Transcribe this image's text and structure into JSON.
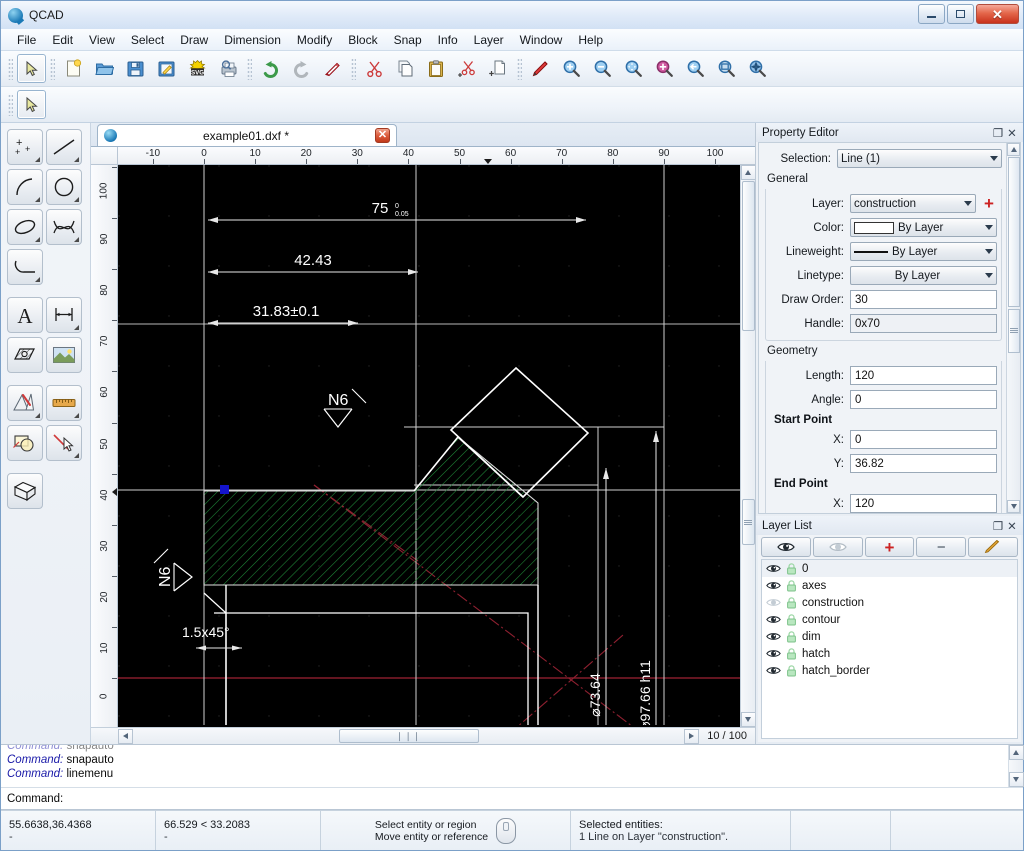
{
  "window": {
    "title": "QCAD",
    "minimize_label": "Minimize",
    "maximize_label": "Maximize",
    "close_label": "✕"
  },
  "menubar": {
    "items": [
      {
        "label": "File"
      },
      {
        "label": "Edit"
      },
      {
        "label": "View"
      },
      {
        "label": "Select"
      },
      {
        "label": "Draw"
      },
      {
        "label": "Dimension"
      },
      {
        "label": "Modify"
      },
      {
        "label": "Block"
      },
      {
        "label": "Snap"
      },
      {
        "label": "Info"
      },
      {
        "label": "Layer"
      },
      {
        "label": "Window"
      },
      {
        "label": "Help"
      }
    ]
  },
  "toolbar": {
    "items": [
      {
        "name": "select-pointer-icon",
        "tooltip": "Select"
      },
      {
        "name": "new-file-icon",
        "tooltip": "New"
      },
      {
        "name": "open-folder-icon",
        "tooltip": "Open"
      },
      {
        "name": "save-icon",
        "tooltip": "Save"
      },
      {
        "name": "save-as-icon",
        "tooltip": "Save As"
      },
      {
        "name": "export-svg-icon",
        "tooltip": "Export SVG"
      },
      {
        "name": "print-preview-icon",
        "tooltip": "Print Preview"
      },
      {
        "name": "undo-icon",
        "tooltip": "Undo"
      },
      {
        "name": "redo-icon",
        "tooltip": "Redo"
      },
      {
        "name": "erase-icon",
        "tooltip": "Erase"
      },
      {
        "name": "cut-icon",
        "tooltip": "Cut"
      },
      {
        "name": "cut-scissors-icon",
        "tooltip": "Cut"
      },
      {
        "name": "copy-icon",
        "tooltip": "Copy"
      },
      {
        "name": "paste-icon",
        "tooltip": "Paste"
      },
      {
        "name": "cut-ref-icon",
        "tooltip": "Cut with reference"
      },
      {
        "name": "copy-ref-icon",
        "tooltip": "Copy with reference"
      },
      {
        "name": "pencil-draw-icon",
        "tooltip": "Draw"
      },
      {
        "name": "zoom-in-icon",
        "tooltip": "Zoom In"
      },
      {
        "name": "zoom-out-icon",
        "tooltip": "Zoom Out"
      },
      {
        "name": "zoom-auto-icon",
        "tooltip": "Auto Zoom"
      },
      {
        "name": "zoom-selection-icon",
        "tooltip": "Zoom to Selection"
      },
      {
        "name": "zoom-previous-icon",
        "tooltip": "Previous View"
      },
      {
        "name": "zoom-window-icon",
        "tooltip": "Zoom Window"
      },
      {
        "name": "zoom-pan-icon",
        "tooltip": "Pan Zoom"
      }
    ],
    "row2": [
      {
        "name": "select-pointer-icon",
        "tooltip": "Select Entity"
      }
    ]
  },
  "tool_palette": {
    "items": [
      {
        "name": "point-tool",
        "label": "Point",
        "has_menu": true
      },
      {
        "name": "line-tool",
        "label": "Line",
        "has_menu": true
      },
      {
        "name": "arc-tool",
        "label": "Arc",
        "has_menu": true
      },
      {
        "name": "circle-tool",
        "label": "Circle",
        "has_menu": true
      },
      {
        "name": "ellipse-tool",
        "label": "Ellipse",
        "has_menu": true
      },
      {
        "name": "spline-tool",
        "label": "Spline",
        "has_menu": true
      },
      {
        "name": "polyline-tool",
        "label": "Polyline",
        "has_menu": true
      },
      {
        "name": "text-tool",
        "label": "Text",
        "has_menu": false
      },
      {
        "name": "dimension-tool",
        "label": "Dimension",
        "has_menu": true
      },
      {
        "name": "hatch-tool",
        "label": "Hatch",
        "has_menu": false
      },
      {
        "name": "image-tool",
        "label": "Image",
        "has_menu": false
      },
      {
        "name": "modify-tool",
        "label": "Modify",
        "has_menu": true
      },
      {
        "name": "measure-tool",
        "label": "Measure",
        "has_menu": true
      },
      {
        "name": "block-tool",
        "label": "Block",
        "has_menu": false
      },
      {
        "name": "snap-tool",
        "label": "Snap",
        "has_menu": true
      },
      {
        "name": "isometric-tool",
        "label": "Isometric",
        "has_menu": false
      }
    ]
  },
  "tab": {
    "label": "example01.dxf *",
    "close_label": "✕"
  },
  "canvas": {
    "h_ruler_ticks": [
      -10,
      0,
      10,
      20,
      30,
      40,
      50,
      60,
      70,
      80,
      90,
      100
    ],
    "v_ruler_ticks": [
      0,
      10,
      20,
      30,
      40,
      50,
      60,
      70,
      80,
      90,
      100
    ],
    "zoom_indicator": "10 / 100",
    "scroll_thumb_glyph": "❘❘❘",
    "annotations": {
      "dim_top": "75",
      "dim_top_tol_upper": "0",
      "dim_top_tol_lower": "0.05",
      "dim_mid": "42.43",
      "dim_low": "31.83±0.1",
      "dim_vert_inner": "⌹73.64",
      "dim_vert_outer": "⌹97.66  h11",
      "chamfer": "1.5x45°",
      "surface_top": "N6",
      "surface_left": "N6"
    },
    "colors": {
      "background": "#000000",
      "geometry": "#ffffff",
      "hatch": "#1f7a34",
      "centerline": "#aa2233",
      "construction": "#8b1f2f",
      "selection_handle": "#1414cc"
    }
  },
  "property_editor": {
    "title": "Property Editor",
    "selection_label": "Selection:",
    "selection_value": "Line (1)",
    "general_header": "General",
    "general": [
      {
        "label": "Layer:",
        "value": "construction",
        "kind": "combo-plus"
      },
      {
        "label": "Color:",
        "value": "By Layer",
        "kind": "combo-swatch"
      },
      {
        "label": "Lineweight:",
        "value": "By Layer",
        "kind": "combo-lineweight"
      },
      {
        "label": "Linetype:",
        "value": "By Layer",
        "kind": "combo"
      },
      {
        "label": "Draw Order:",
        "value": "30",
        "kind": "text"
      },
      {
        "label": "Handle:",
        "value": "0x70",
        "kind": "text-readonly"
      }
    ],
    "geometry_header": "Geometry",
    "geometry": [
      {
        "label": "Length:",
        "value": "120",
        "kind": "text"
      },
      {
        "label": "Angle:",
        "value": "0",
        "kind": "text"
      }
    ],
    "start_point_header": "Start Point",
    "start_point": [
      {
        "label": "X:",
        "value": "0"
      },
      {
        "label": "Y:",
        "value": "36.82"
      }
    ],
    "end_point_header": "End Point",
    "end_point": [
      {
        "label": "X:",
        "value": "120"
      }
    ],
    "add_layer_label": "+",
    "float_label": "❐",
    "close_label": "✕"
  },
  "layer_list": {
    "title": "Layer List",
    "float_label": "❐",
    "close_label": "✕",
    "toolbar": [
      {
        "name": "show-all-layers-button",
        "label": "eye-open"
      },
      {
        "name": "hide-all-layers-button",
        "label": "eye-closed"
      },
      {
        "name": "add-layer-button",
        "label": "+"
      },
      {
        "name": "remove-layer-button",
        "label": "−"
      },
      {
        "name": "edit-layer-button",
        "label": "pencil"
      }
    ],
    "layers": [
      {
        "name": "0",
        "visible": true,
        "locked": false,
        "selected": true
      },
      {
        "name": "axes",
        "visible": true,
        "locked": false,
        "selected": false
      },
      {
        "name": "construction",
        "visible": false,
        "locked": false,
        "selected": false
      },
      {
        "name": "contour",
        "visible": true,
        "locked": false,
        "selected": false
      },
      {
        "name": "dim",
        "visible": true,
        "locked": false,
        "selected": false
      },
      {
        "name": "hatch",
        "visible": true,
        "locked": false,
        "selected": false
      },
      {
        "name": "hatch_border",
        "visible": true,
        "locked": false,
        "selected": false
      }
    ]
  },
  "command_area": {
    "history": [
      {
        "prefix": "Command:",
        "text": " snapauto",
        "faded": true
      },
      {
        "prefix": "Command:",
        "text": " snapauto",
        "faded": false
      },
      {
        "prefix": "Command:",
        "text": " linemenu",
        "faded": false
      }
    ],
    "prompt_label": "Command:",
    "prompt_value": ""
  },
  "status_bar": {
    "absolute_coord": "55.6638,36.4368",
    "absolute_sub": "-",
    "relative_coord": "66.529 < 33.2083",
    "relative_sub": "-",
    "hint_line1": "Select entity or region",
    "hint_line2": "Move entity or reference",
    "selection_line1": "Selected entities:",
    "selection_line2": "1 Line on Layer \"construction\"."
  }
}
